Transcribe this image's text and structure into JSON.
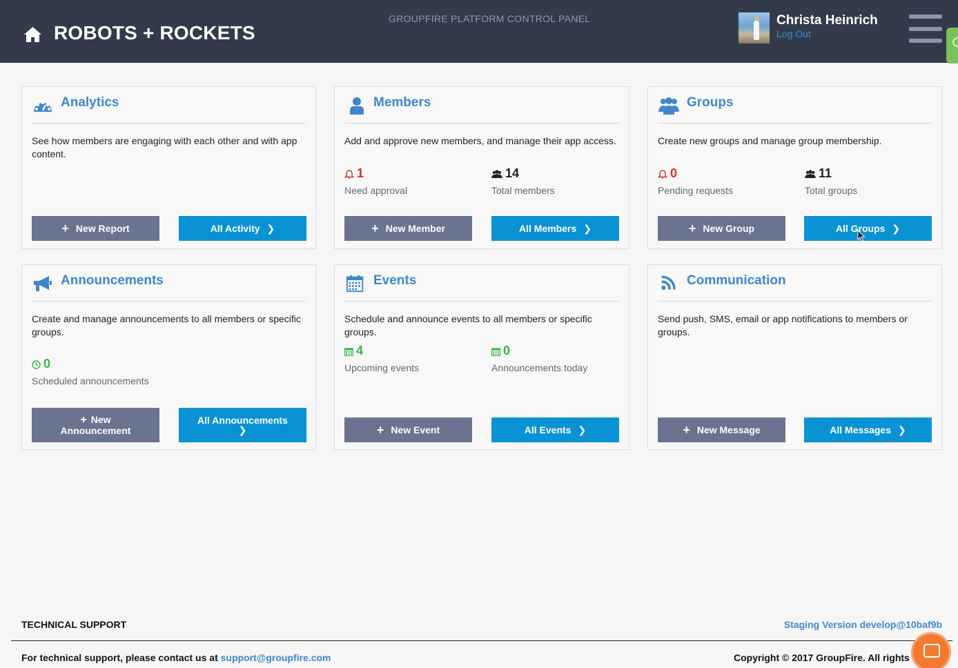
{
  "header": {
    "brand": "ROBOTS + ROCKETS",
    "platform_title": "GROUPFIRE PLATFORM CONTROL PANEL",
    "user_name": "Christa Heinrich",
    "logout": "Log Out"
  },
  "cards": {
    "analytics": {
      "title": "Analytics",
      "description": "See how members are engaging with each other and with app content.",
      "primary_btn": "New Report",
      "secondary_btn": "All Activity"
    },
    "members": {
      "title": "Members",
      "description": "Add and approve new members, and manage their app access.",
      "stat1_value": "1",
      "stat1_label": "Need approval",
      "stat2_value": "14",
      "stat2_label": "Total members",
      "primary_btn": "New Member",
      "secondary_btn": "All Members"
    },
    "groups": {
      "title": "Groups",
      "description": "Create new groups and manage group membership.",
      "stat1_value": "0",
      "stat1_label": "Pending requests",
      "stat2_value": "11",
      "stat2_label": "Total groups",
      "primary_btn": "New Group",
      "secondary_btn": "All Groups"
    },
    "announcements": {
      "title": "Announcements",
      "description": "Create and manage announcements to all members or specific groups.",
      "stat1_value": "0",
      "stat1_label": "Scheduled announcements",
      "primary_btn_line1": "New",
      "primary_btn_line2": "Announcement",
      "secondary_btn": "All Announcements"
    },
    "events": {
      "title": "Events",
      "description": "Schedule and announce events to all members or specific groups.",
      "stat1_value": "4",
      "stat1_label": "Upcoming events",
      "stat2_value": "0",
      "stat2_label": "Announcements today",
      "primary_btn": "New Event",
      "secondary_btn": "All Events"
    },
    "communication": {
      "title": "Communication",
      "description": "Send push, SMS, email or app notifications to members or groups.",
      "primary_btn": "New Message",
      "secondary_btn": "All Messages"
    }
  },
  "footer": {
    "tech_support_title": "TECHNICAL SUPPORT",
    "version": "Staging Version develop@10baf9b",
    "support_text": "For technical support, please contact us at ",
    "support_email": "support@groupfire.com",
    "copyright": "Copyright © 2017 GroupFire. All rights reserved."
  },
  "colors": {
    "header_bg": "#333a49",
    "accent_blue": "#0a93d4",
    "button_gray": "#6a7491",
    "title_blue": "#3f87c9",
    "alert_red": "#d0302f",
    "success_green": "#35b54b"
  }
}
